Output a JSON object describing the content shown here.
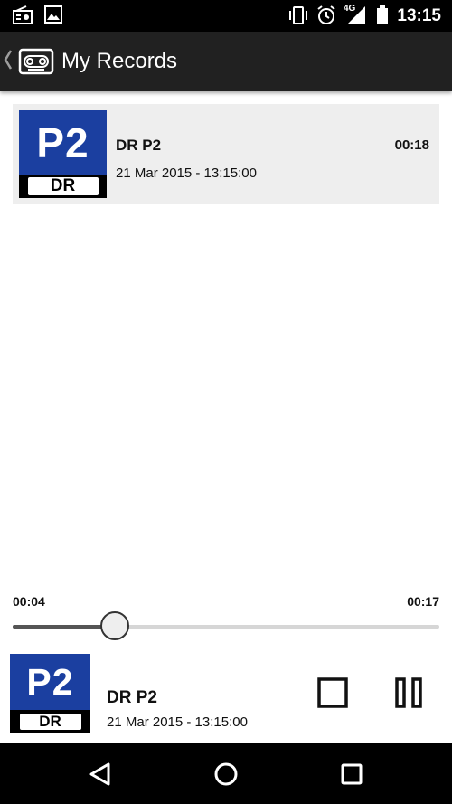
{
  "status_bar": {
    "time": "13:15",
    "network": "4G",
    "left_icons": [
      "radio-icon",
      "image-icon"
    ],
    "right_icons": [
      "vibrate-icon",
      "alarm-icon",
      "signal-icon",
      "battery-icon"
    ]
  },
  "action_bar": {
    "title": "My Records",
    "icon": "cassette-icon"
  },
  "records": [
    {
      "logo_top": "P2",
      "logo_bottom": "DR",
      "title": "DR P2",
      "date": "21 Mar 2015 - 13:15:00",
      "duration": "00:18"
    }
  ],
  "player": {
    "elapsed": "00:04",
    "total": "00:17",
    "progress": 0.24,
    "logo_top": "P2",
    "logo_bottom": "DR",
    "title": "DR P2",
    "date": "21 Mar 2015 - 13:15:00",
    "controls": [
      "stop-icon",
      "pause-icon"
    ]
  },
  "nav_bar": {
    "buttons": [
      "back-icon",
      "home-icon",
      "recents-icon"
    ]
  },
  "colors": {
    "status_bar_bg": "#000000",
    "action_bar_bg": "#212121",
    "record_bg": "#eeeeee",
    "p2_blue": "#1b3fa0",
    "seek_fill": "#555555",
    "seek_track": "#d6d6d6"
  }
}
